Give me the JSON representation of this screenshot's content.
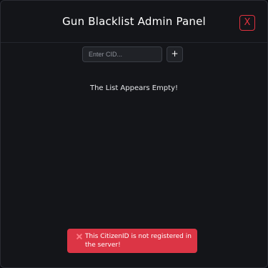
{
  "panel": {
    "title": "Gun Blacklist Admin Panel",
    "close_label": "X"
  },
  "search": {
    "placeholder": "Enter CID...",
    "value": "",
    "add_label": "+"
  },
  "list": {
    "empty_message": "The List Appears Empty!",
    "items": []
  },
  "toast": {
    "type": "error",
    "icon": "x-icon",
    "message": "This CitizenID is not registered in the server!"
  },
  "colors": {
    "background": "#141519",
    "accent_red": "#e0323f",
    "toast_red": "#dc3545",
    "text": "#ffffff"
  }
}
